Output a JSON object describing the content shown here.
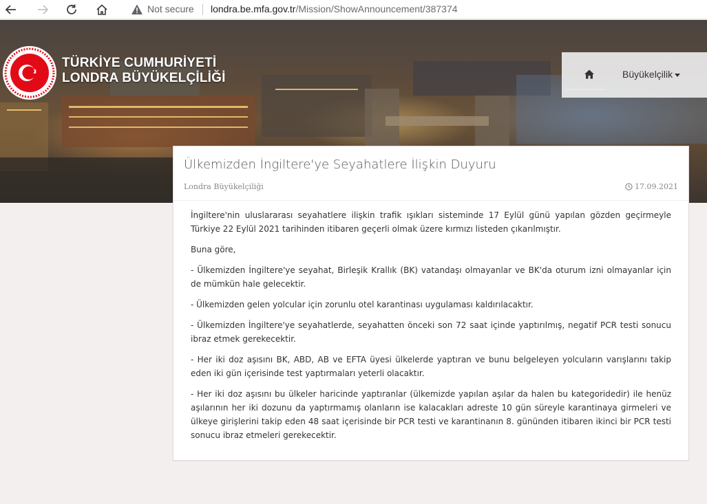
{
  "browser": {
    "security_label": "Not secure",
    "url_host": "londra.be.mfa.gov.tr",
    "url_path": "/Mission/ShowAnnouncement/387374",
    "icons": [
      "back-icon",
      "forward-icon",
      "reload-icon",
      "home-icon",
      "warning-icon"
    ]
  },
  "header": {
    "brand_line1": "TÜRKİYE CUMHURİYETİ",
    "brand_line2": "LONDRA BÜYÜKELÇİLİĞİ",
    "nav": {
      "home_icon": "home-icon",
      "dropdown_label": "Büyükelçilik"
    }
  },
  "announcement": {
    "title": "Ülkemizden İngiltere'ye Seyahatlere İlişkin Duyuru",
    "source": "Londra Büyükelçiliği",
    "date": "17.09.2021",
    "paragraphs": [
      "İngiltere'nin uluslararası seyahatlere ilişkin trafik ışıkları sisteminde 17 Eylül günü yapılan gözden geçirmeyle Türkiye 22 Eylül 2021 tarihinden itibaren geçerli olmak üzere kırmızı listeden çıkarılmıştır.",
      "Buna göre,",
      "- Ülkemizden İngiltere'ye seyahat, Birleşik Krallık (BK) vatandaşı olmayanlar ve BK'da oturum izni olmayanlar için de mümkün hale gelecektir.",
      "- Ülkemizden gelen yolcular için zorunlu otel karantinası uygulaması kaldırılacaktır.",
      "- Ülkemizden İngiltere'ye seyahatlerde, seyahatten önceki son 72 saat içinde yaptırılmış, negatif PCR testi sonucu ibraz etmek gerekecektir.",
      "- Her iki doz aşısını BK, ABD, AB ve EFTA üyesi ülkelerde yaptıran ve bunu belgeleyen yolcuların varışlarını takip eden iki gün içerisinde test yaptırmaları yeterli olacaktır.",
      "- Her iki doz aşısını bu ülkeler haricinde yaptıranlar (ülkemizde yapılan aşılar da halen bu kategoridedir) ile henüz aşılarının her iki dozunu da yaptırmamış olanların ise kalacakları adreste 10 gün süreyle karantinaya girmeleri ve ülkeye girişlerini takip eden 48 saat içerisinde bir PCR testi ve karantinanın 8. gününden itibaren ikinci bir PCR testi sonucu ibraz etmeleri gerekecektir."
    ]
  },
  "colors": {
    "page_bg": "#f4efef",
    "emblem_red": "#e30a17",
    "text": "#333333",
    "muted": "#888888"
  }
}
